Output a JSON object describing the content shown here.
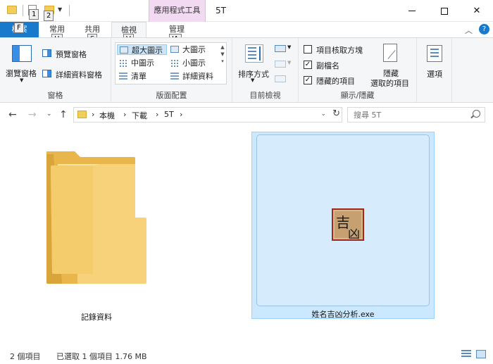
{
  "titlebar": {
    "contextual_tab": "應用程式工具",
    "title": "5T",
    "keytips": {
      "qa1": "1",
      "qa2": "2",
      "file": "F",
      "home": "H",
      "share": "S",
      "view": "V",
      "manage": "JA"
    }
  },
  "tabs": {
    "file": "檔案",
    "home": "常用",
    "share": "共用",
    "view": "檢視",
    "manage": "管理"
  },
  "ribbon": {
    "panes": {
      "navigation_pane": "瀏覽窗格",
      "preview_pane": "預覽窗格",
      "details_pane": "詳細資料窗格",
      "label": "窗格"
    },
    "layout": {
      "items": [
        "超大圖示",
        "大圖示",
        "中圖示",
        "小圖示",
        "清單",
        "詳細資料"
      ],
      "selected": "超大圖示",
      "label": "版面配置"
    },
    "current_view": {
      "sort_by": "排序方式",
      "label": "目前檢視"
    },
    "show_hide": {
      "item_checkboxes": "項目核取方塊",
      "item_checkboxes_checked": false,
      "file_extensions": "副檔名",
      "file_extensions_checked": true,
      "hidden_items": "隱藏的項目",
      "hidden_items_checked": true,
      "hide_selected_line1": "隱藏",
      "hide_selected_line2": "選取的項目",
      "label": "顯示/隱藏"
    },
    "options": "選項"
  },
  "navbar": {
    "breadcrumb": [
      "本機",
      "下載",
      "5T"
    ],
    "search_placeholder": "搜尋 5T"
  },
  "files": [
    {
      "name": "記錄資料",
      "type": "folder"
    },
    {
      "name": "姓名吉凶分析.exe",
      "type": "application",
      "selected": true,
      "icon_text_1": "吉",
      "icon_text_2": "凶"
    }
  ],
  "status": {
    "item_count": "2 個項目",
    "selected_info": "已選取 1 個項目  1.76 MB"
  }
}
